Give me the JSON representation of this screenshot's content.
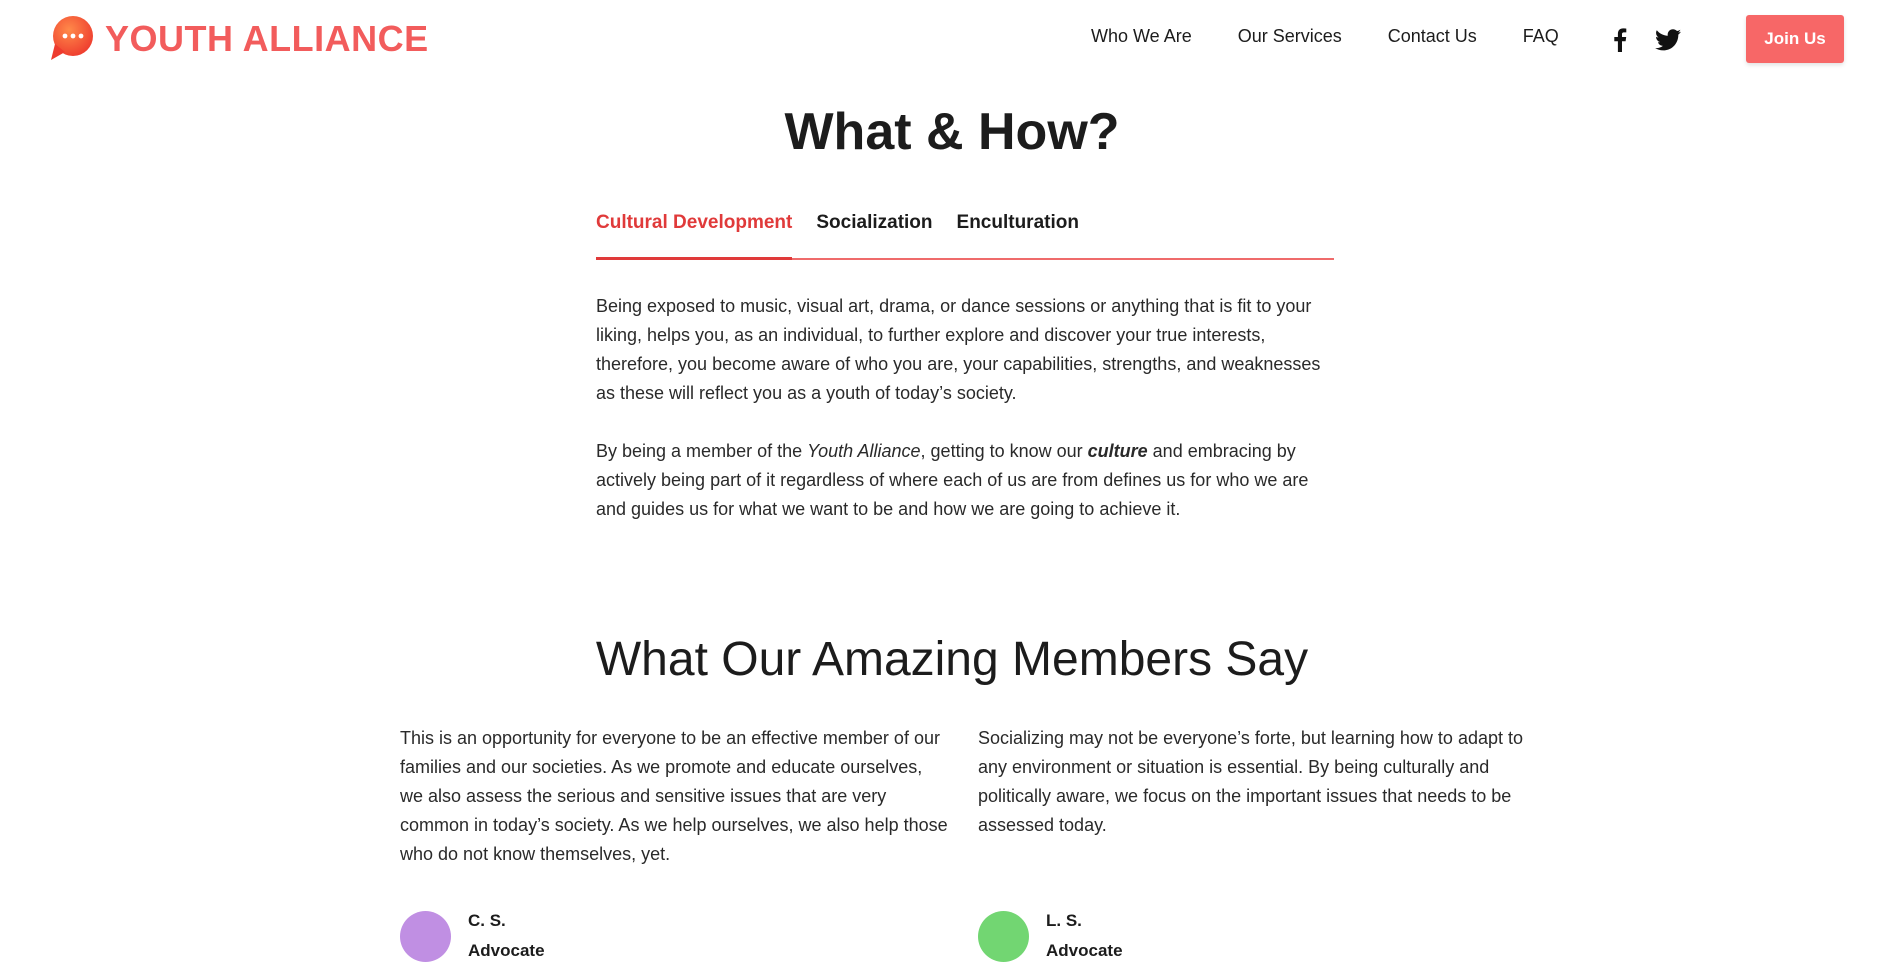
{
  "header": {
    "brand": "YOUTH ALLIANCE",
    "brand_color": "#f25c5c",
    "logo_icon": "speech-bubble-icon",
    "nav": [
      {
        "label": "Who We Are"
      },
      {
        "label": "Our Services"
      },
      {
        "label": "Contact Us"
      },
      {
        "label": "FAQ"
      }
    ],
    "social": [
      {
        "icon": "facebook-icon"
      },
      {
        "icon": "twitter-icon"
      }
    ],
    "join_label": "Join Us",
    "join_color": "#f76767"
  },
  "what_how": {
    "title": "What & How?",
    "tabs": [
      {
        "label": "Cultural Development",
        "active": true
      },
      {
        "label": "Socialization",
        "active": false
      },
      {
        "label": "Enculturation",
        "active": false
      }
    ],
    "accent_color": "#e03a3a",
    "paragraph1": "Being exposed to music, visual art, drama, or dance sessions or anything that is fit to your liking, helps you, as an individual, to further explore and discover your true interests, therefore, you become aware of who you are, your capabilities, strengths, and weaknesses as these will reflect you as a youth of today’s society.",
    "paragraph2": {
      "part1": "By being a member of the ",
      "em": "Youth Alliance",
      "part2": ", getting to know our ",
      "strong": "culture",
      "part3": " and embracing by actively being part of it regardless of where each of us are from defines us for who we are and guides us for what we want to be and how we are going to achieve it."
    }
  },
  "testimonials": {
    "title": "What Our Amazing Members Say",
    "items": [
      {
        "text": "This is an opportunity for everyone to be an effective member of our families and our societies. As we promote and educate ourselves, we also assess the serious and sensitive issues that are very common in today’s society. As we help ourselves, we also help those who do not know themselves, yet.",
        "name": "C. S.",
        "role": "Advocate",
        "avatar_color": "#c08fe3"
      },
      {
        "text": "Socializing may not be everyone’s forte, but learning how to adapt to any environment or situation is essential. By being culturally and politically aware, we focus on the important issues that needs to be assessed today.",
        "name": "L. S.",
        "role": "Advocate",
        "avatar_color": "#72d672"
      }
    ]
  }
}
